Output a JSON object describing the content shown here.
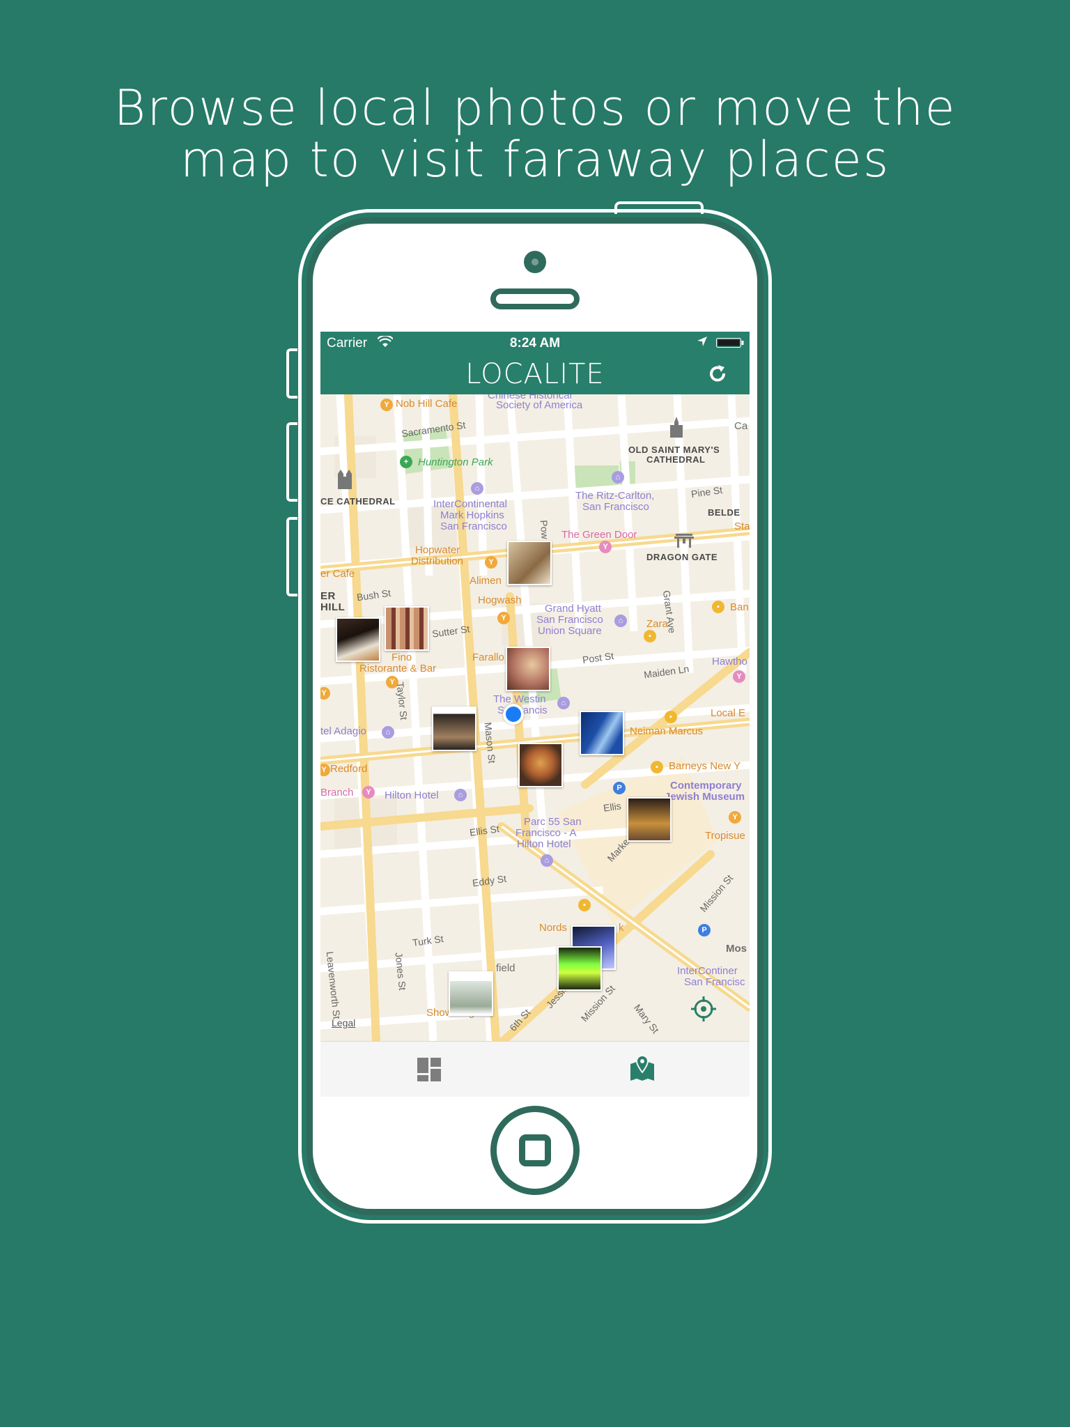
{
  "headline": {
    "line1": "Browse local photos or move the",
    "line2": "map to visit faraway places"
  },
  "colors": {
    "background": "#267a67",
    "app_bar": "#287f6b",
    "phone_outline": "#2f6b5c",
    "user_location": "#1a7cf5"
  },
  "status_bar": {
    "carrier": "Carrier",
    "time": "8:24 AM",
    "icons": [
      "wifi-icon",
      "location-arrow-icon",
      "battery-icon"
    ]
  },
  "nav_bar": {
    "title": "LOCALITE",
    "right_icon": "refresh-icon"
  },
  "map": {
    "labels": {
      "nob_hill_cafe": "Nob Hill Cafe",
      "chinese_hist_1": "Chinese Historical",
      "chinese_hist_2": "Society of America",
      "sacramento_st": "Sacramento St",
      "ca_edge": "Ca",
      "old_st_marys_1": "OLD SAINT MARY'S",
      "old_st_marys_2": "CATHEDRAL",
      "huntington_park": "Huntington Park",
      "cathedral": "CE CATHEDRAL",
      "intercontinental_1": "InterContinental",
      "intercontinental_2": "Mark Hopkins",
      "intercontinental_3": "San Francisco",
      "ritz_1": "The Ritz-Carlton,",
      "ritz_2": "San Francisco",
      "pine_st": "Pine St",
      "belden": "BELDE",
      "sta": "Sta",
      "powell": "Pow",
      "green_door": "The Green Door",
      "dragon_gate": "DRAGON GATE",
      "hopwater_1": "Hopwater",
      "hopwater_2": "Distribution",
      "cafe": "er Cafe",
      "alimen": "Alimen",
      "hill_1": "ER",
      "hill_2": "HILL",
      "bush_st": "Bush St",
      "hogwash": "Hogwash",
      "grand_hyatt_1": "Grand Hyatt",
      "grand_hyatt_2": "San Francisco",
      "grand_hyatt_3": "Union Square",
      "grant_ave": "Grant Ave",
      "ban": "Ban",
      "zara": "Zara",
      "sutter_st": "Sutter St",
      "farallon": "Farallo",
      "fino_1": "Fino",
      "fino_2": "Ristorante & Bar",
      "post_st": "Post St",
      "maiden_ln": "Maiden Ln",
      "hawth": "Hawtho",
      "taylor_st": "Taylor St",
      "westin_1": "The Westin",
      "westin_2": "St. Francis",
      "local_e": "Local E",
      "hotel_adagio": "tel Adagio",
      "mason_st": "Mason St",
      "neiman": "Neiman Marcus",
      "redford": "Redford",
      "barneys": "Barneys New Y",
      "contemporary_1": "Contemporary",
      "contemporary_2": "Jewish Museum",
      "branch": "Branch",
      "hilton_hotel": "Hilton Hotel",
      "ellis_st_r": "Ellis",
      "ellis_st": "Ellis St",
      "parc55_1": "Parc 55 San",
      "parc55_2": "Francisco - A",
      "parc55_3": "Hilton Hotel",
      "tropisue": "Tropisue",
      "market": "Marke",
      "eddy_st": "Eddy St",
      "mission_st_r": "Mission St",
      "nordstrom": "Nords",
      "nordstrom_k": "k",
      "turk_st": "Turk St",
      "mos": "Mos",
      "leavenworth": "Leavenworth St",
      "jones_st": "Jones St",
      "field": "field",
      "intercontinental_sf_1": "InterContiner",
      "intercontinental_sf_2": "San Francisc",
      "show_dogs": "Show Dogs",
      "sixth_st": "6th St",
      "jessie": "Jessie",
      "mission_st": "Mission St",
      "mary_st": "Mary St",
      "legal": "Legal"
    },
    "photo_pins": [
      {
        "name": "photo-pastry",
        "colors": [
          "#d8c3a0",
          "#8a6a45"
        ]
      },
      {
        "name": "photo-dinner-table",
        "colors": [
          "#3a2a20",
          "#e8e0d0"
        ]
      },
      {
        "name": "photo-people-collage",
        "colors": [
          "#c9906e",
          "#7a3b2e"
        ]
      },
      {
        "name": "photo-selfie",
        "colors": [
          "#b07060",
          "#e9c8a0"
        ]
      },
      {
        "name": "photo-group",
        "colors": [
          "#2a2420",
          "#a08060"
        ]
      },
      {
        "name": "photo-skyscraper",
        "colors": [
          "#1d4fa8",
          "#9cc6f0"
        ]
      },
      {
        "name": "photo-food-plate",
        "colors": [
          "#4a3020",
          "#e0a050"
        ]
      },
      {
        "name": "photo-street-night",
        "colors": [
          "#2a1e18",
          "#c8903c"
        ]
      },
      {
        "name": "photo-concert-1",
        "colors": [
          "#101830",
          "#c0c8ff"
        ]
      },
      {
        "name": "photo-concert-2",
        "colors": [
          "#1a2a10",
          "#80ff40"
        ]
      },
      {
        "name": "photo-building",
        "colors": [
          "#dde6de",
          "#9aaa98"
        ]
      }
    ],
    "controls": {
      "locate_icon": "crosshair-icon"
    }
  },
  "tab_bar": {
    "tabs": [
      {
        "icon": "grid-icon",
        "selected": false
      },
      {
        "icon": "map-marker-icon",
        "selected": true
      }
    ]
  }
}
